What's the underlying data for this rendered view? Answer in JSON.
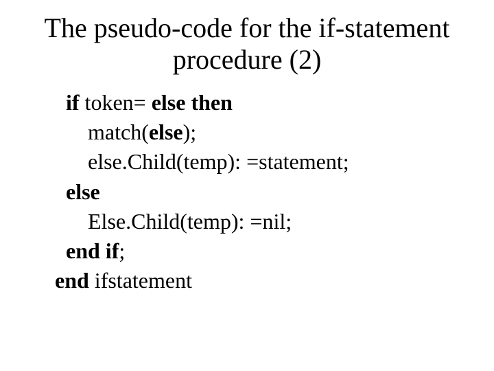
{
  "title_line1": "The pseudo-code for the if-statement",
  "title_line2": "procedure (2)",
  "code": {
    "l1_if": "if",
    "l1_mid": " token= ",
    "l1_else": "else",
    "l1_then": " then",
    "l2_pre": "match(",
    "l2_else": "else",
    "l2_post": ");",
    "l3": "else.Child(temp): =statement;",
    "l4": "else",
    "l5": "Else.Child(temp): =nil;",
    "l6_end": "end if",
    "l6_semi": ";",
    "l7_end": "end",
    "l7_rest": " ifstatement"
  }
}
